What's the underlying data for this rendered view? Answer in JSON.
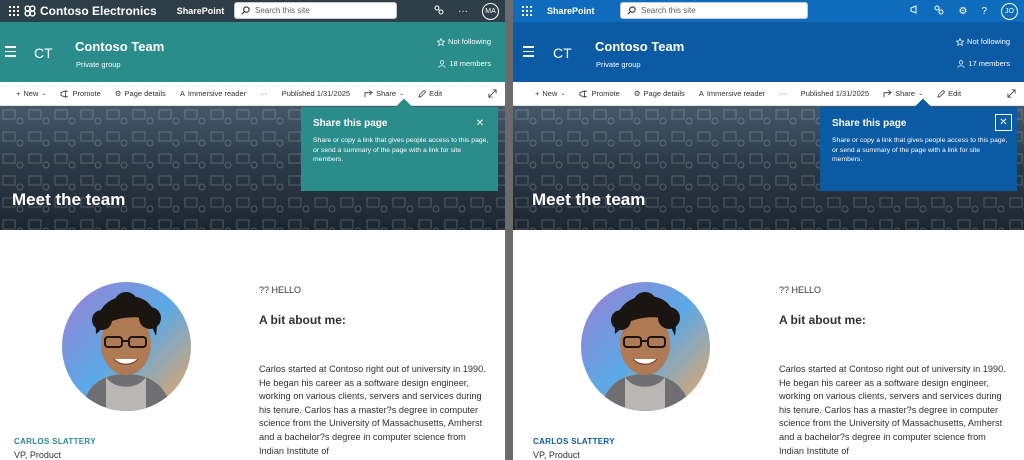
{
  "colors": {
    "left_theme": "#2a8d8b",
    "left_suite": "#2d3e48",
    "right_theme": "#0b5aa4",
    "right_suite": "#0f6cbd"
  },
  "left": {
    "suite": {
      "brand": "Contoso Electronics",
      "app": "SharePoint",
      "search_placeholder": "Search this site",
      "avatar": "MA"
    },
    "site": {
      "logo": "CT",
      "title": "Contoso Team",
      "subtitle": "Private group",
      "follow": "Not following",
      "members": "18 members"
    },
    "command": {
      "new": "New",
      "promote": "Promote",
      "page_details": "Page details",
      "immersive": "Immersive reader",
      "more": "···",
      "published": "Published 1/31/2025",
      "share": "Share",
      "edit": "Edit"
    },
    "banner": {
      "heading": "Meet the team"
    },
    "bubble": {
      "title": "Share this page",
      "text": "Share or copy a link that gives people access to this page, or send a summary of the page with a link for site members."
    },
    "profile": {
      "name": "CARLOS SLATTERY",
      "role": "VP, Product",
      "hello": "?? HELLO",
      "about": "A bit about me:",
      "bio": "Carlos started at Contoso right out of university in 1990. He began his career as a software design engineer, working on various clients, servers and services during his tenure. Carlos has a master?s degree in computer science from the University of Massachusetts, Amherst and a bachelor?s degree in computer science from Indian Institute of"
    }
  },
  "right": {
    "suite": {
      "app": "SharePoint",
      "search_placeholder": "Search this site",
      "avatar": "JO"
    },
    "site": {
      "logo": "CT",
      "title": "Contoso Team",
      "subtitle": "Private group",
      "follow": "Not following",
      "members": "17 members"
    },
    "command": {
      "new": "New",
      "promote": "Promote",
      "page_details": "Page details",
      "immersive": "Immersive reader",
      "more": "···",
      "published": "Published 1/31/2025",
      "share": "Share",
      "edit": "Edit"
    },
    "banner": {
      "heading": "Meet the team"
    },
    "bubble": {
      "title": "Share this page",
      "text": "Share or copy a link that gives people access to this page, or send a summary of the page with a link for site members."
    },
    "profile": {
      "name": "CARLOS SLATTERY",
      "role": "VP, Product",
      "hello": "?? HELLO",
      "about": "A bit about me:",
      "bio": "Carlos started at Contoso right out of university in 1990. He began his career as a software design engineer, working on various clients, servers and services during his tenure. Carlos has a master?s degree in computer science from the University of Massachusetts, Amherst and a bachelor?s degree in computer science from Indian Institute of"
    }
  }
}
